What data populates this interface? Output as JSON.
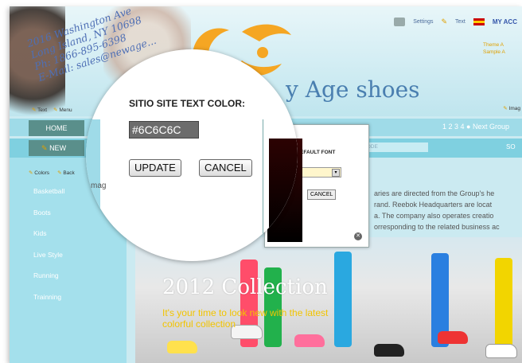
{
  "address": {
    "line1": "2016 Washington Ave",
    "line2": "Long Island, NY 10698",
    "line3": "Ph: 1866-895-6398",
    "line4": "E-Mail: sales@newage..."
  },
  "brand": {
    "name": "y Age shoes"
  },
  "topnav": {
    "settings": "Settings",
    "text": "Text",
    "account": "MY ACC"
  },
  "themes": {
    "theme": "Theme A",
    "sample": "Sample A"
  },
  "editbar": {
    "text": "Text",
    "menu": "Menu",
    "image": "Imag"
  },
  "nav": {
    "home": "HOME",
    "new": "NEW",
    "pager": "1 2 3 4",
    "next": "Next Group",
    "code": "CODE",
    "so": "SO"
  },
  "sidebar": {
    "edit_colors": "Colors",
    "edit_back": "Back",
    "items": [
      "Basketball",
      "Boots",
      "Kids",
      "Live Style",
      "Running",
      "Trainning"
    ]
  },
  "content": {
    "lines": [
      "aries are directed from the Group's he",
      "rand. Reebok Headquarters are locat",
      "a. The company also operates creatio",
      "orresponding to the related business ac"
    ]
  },
  "small_dialog": {
    "label": "EFAULT FONT",
    "cancel": "CANCEL"
  },
  "lens": {
    "title": "SITIO SITE TEXT COLOR:",
    "color_value": "#6C6C6C",
    "update": "UPDATE",
    "cancel": "CANCEL",
    "imag": "mag"
  },
  "banner": {
    "title": "2012 Collection",
    "tagline1": "It's your time to look new with the latest",
    "tagline2": "colorful collection"
  },
  "colors": {
    "accent_orange": "#f5a623",
    "input_gray": "#6C6C6C",
    "sidebar": "#a4e0ec"
  }
}
